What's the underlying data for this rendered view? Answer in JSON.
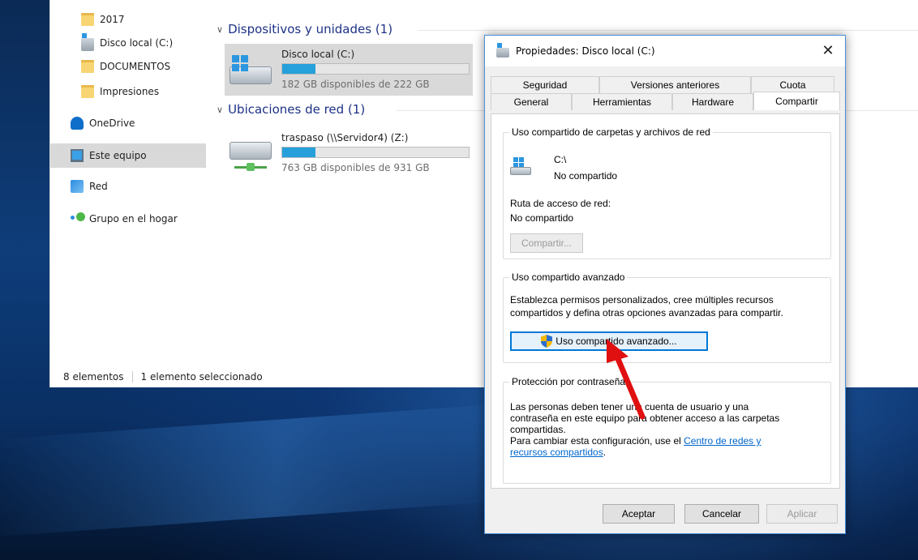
{
  "explorer": {
    "nav": [
      {
        "label": "2017",
        "icon": "folder-icon"
      },
      {
        "label": "Disco local (C:)",
        "icon": "drive-icon"
      },
      {
        "label": "DOCUMENTOS",
        "icon": "folder-icon"
      },
      {
        "label": "Impresiones",
        "icon": "folder-icon"
      },
      {
        "label": "OneDrive",
        "icon": "onedrive-icon"
      },
      {
        "label": "Este equipo",
        "icon": "pc-icon",
        "selected": true
      },
      {
        "label": "Red",
        "icon": "network-icon"
      },
      {
        "label": "Grupo en el hogar",
        "icon": "homegroup-icon"
      }
    ],
    "groups": {
      "devices": "Dispositivos y unidades (1)",
      "network": "Ubicaciones de red (1)"
    },
    "drives": {
      "local": {
        "name": "Disco local (C:)",
        "free": "182 GB disponibles de 222 GB",
        "used_fraction": 0.18
      },
      "network": {
        "name": "traspaso (\\\\Servidor4) (Z:)",
        "free": "763 GB disponibles de 931 GB",
        "used_fraction": 0.18
      }
    },
    "status": {
      "count": "8 elementos",
      "selection": "1 elemento seleccionado"
    }
  },
  "dialog": {
    "title": "Propiedades: Disco local (C:)",
    "close": "✕",
    "tabs_row1": [
      "Seguridad",
      "Versiones anteriores",
      "Cuota"
    ],
    "tabs_row2": [
      "General",
      "Herramientas",
      "Hardware",
      "Compartir"
    ],
    "active_tab": "Compartir",
    "network_sharing": {
      "title": "Uso compartido de carpetas y archivos de red",
      "path": "C:\\",
      "state": "No compartido",
      "route_label": "Ruta de acceso de red:",
      "route_value": "No compartido",
      "share_button": "Compartir..."
    },
    "advanced": {
      "title": "Uso compartido avanzado",
      "description_line1": "Establezca permisos personalizados, cree múltiples recursos",
      "description_line2": "compartidos y defina otras opciones avanzadas para compartir.",
      "button": "Uso compartido avanzado..."
    },
    "password": {
      "title": "Protección por contraseña",
      "line1": "Las personas deben tener una cuenta de usuario y una",
      "line2": "contraseña en este equipo para obtener acceso a las carpetas",
      "line3": "compartidas.",
      "line4": "Para cambiar esta configuración, use el",
      "link1": "Centro de redes y",
      "link2": "recursos compartidos",
      "link_end": "."
    },
    "buttons": {
      "ok": "Aceptar",
      "cancel": "Cancelar",
      "apply": "Aplicar"
    }
  },
  "colors": {
    "accent": "#26a0da",
    "link": "#0066cc",
    "annotation_arrow": "#e01010"
  }
}
